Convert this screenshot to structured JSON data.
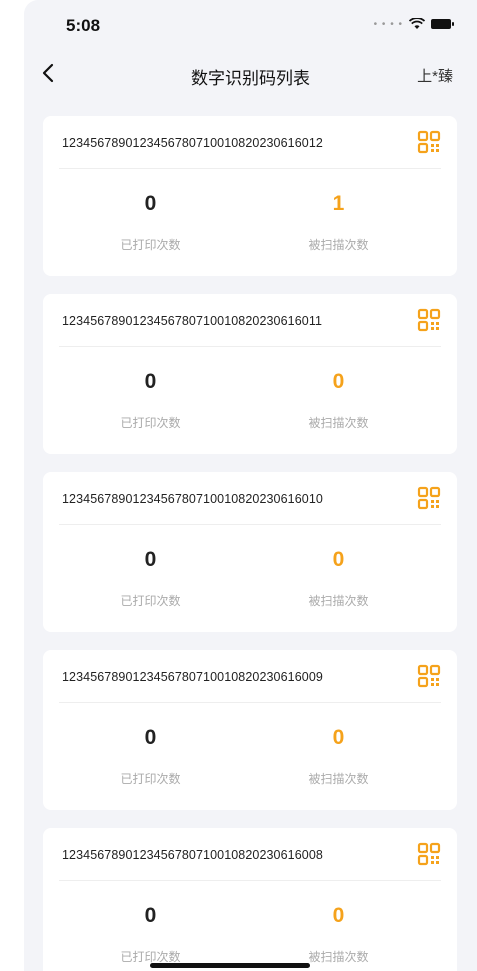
{
  "status": {
    "time": "5:08"
  },
  "nav": {
    "title": "数字识别码列表",
    "user": "上*臻"
  },
  "labels": {
    "printed": "已打印次数",
    "scanned": "被扫描次数"
  },
  "accent": "#f5a21b",
  "cards": [
    {
      "code": "1234567890123456780710010820230616012",
      "printed": "0",
      "scanned": "1"
    },
    {
      "code": "1234567890123456780710010820230616011",
      "printed": "0",
      "scanned": "0"
    },
    {
      "code": "1234567890123456780710010820230616010",
      "printed": "0",
      "scanned": "0"
    },
    {
      "code": "1234567890123456780710010820230616009",
      "printed": "0",
      "scanned": "0"
    },
    {
      "code": "1234567890123456780710010820230616008",
      "printed": "0",
      "scanned": "0"
    }
  ]
}
